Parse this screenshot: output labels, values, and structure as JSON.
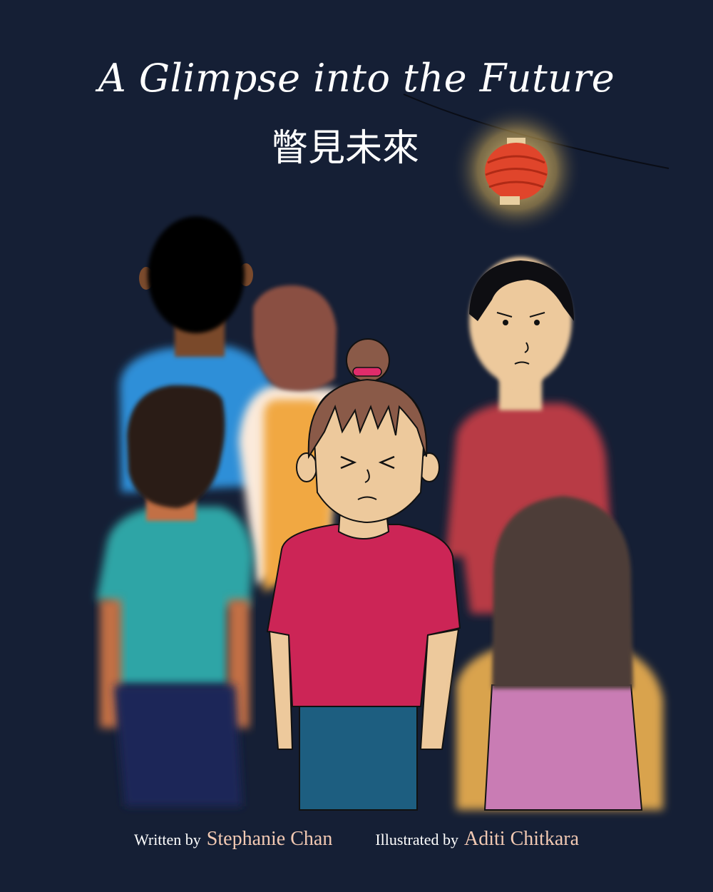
{
  "book": {
    "title": "A Glimpse into the Future",
    "subtitle_chinese": "瞥見未來"
  },
  "credits": {
    "written_label": "Written by",
    "author": "Stephanie Chan",
    "illustrated_label": "Illustrated by",
    "illustrator": "Aditi Chitkara"
  },
  "colors": {
    "background": "#151f35",
    "title_text": "#ffffff",
    "credit_name": "#f2c9b3",
    "lantern": "#e0452b",
    "lantern_glow": "#f0d27a",
    "girl_shirt": "#cc2556",
    "girl_pants": "#1d5e80",
    "boy_shirt": "#2fa5a6",
    "front_right_shirt": "#c97cb4",
    "red_sweater": "#b83a44",
    "back_boy_shirt": "#2f8fd8",
    "yellow_top": "#f1a843",
    "skin_light": "#edc99c"
  },
  "icons": {
    "lantern": "lantern-icon"
  }
}
